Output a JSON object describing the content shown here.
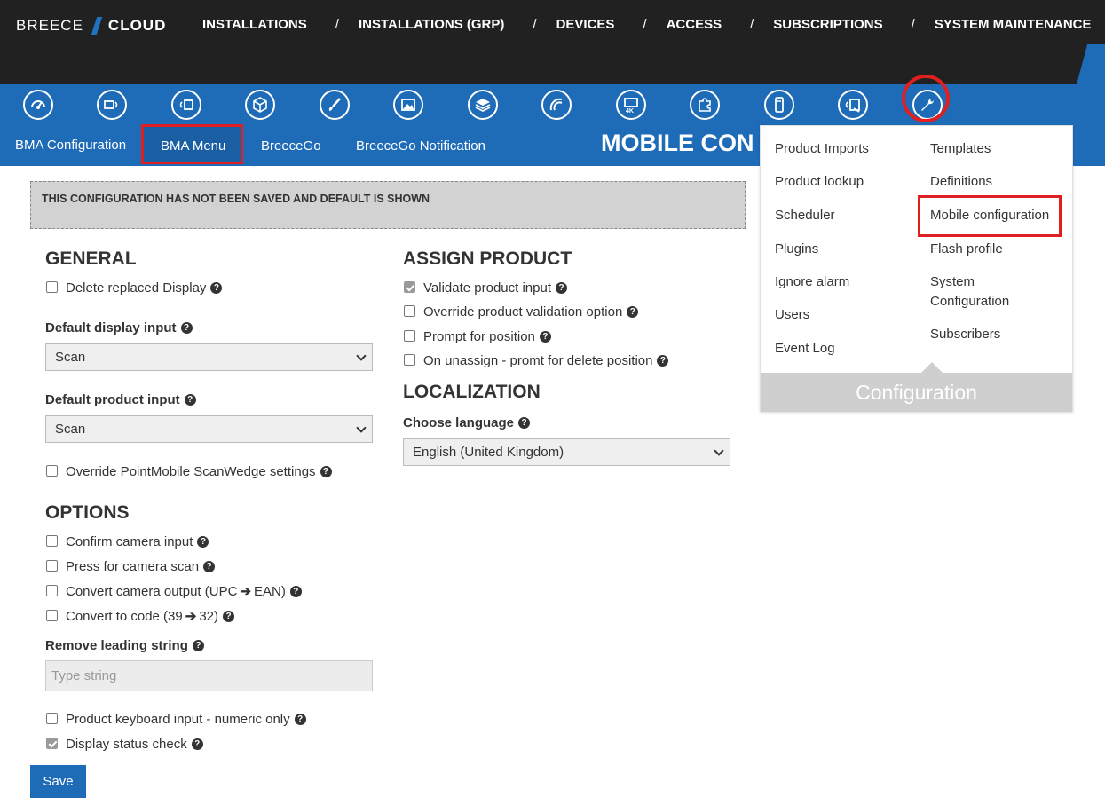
{
  "brand": {
    "left": "BREECE",
    "right": "CLOUD"
  },
  "topnav": [
    "INSTALLATIONS",
    "INSTALLATIONS (GRP)",
    "DEVICES",
    "ACCESS",
    "SUBSCRIPTIONS",
    "SYSTEM MAINTENANCE"
  ],
  "topnav_separator": "/",
  "icons": [
    "dashboard-icon",
    "wireless-display-icon",
    "wall-display-icon",
    "box-icon",
    "brush-icon",
    "images-icon",
    "layers-icon",
    "signal-icon",
    "4k-monitor-icon",
    "puzzle-icon",
    "mobile-scanner-icon",
    "tablet-signal-icon",
    "wrench-icon"
  ],
  "subnav": [
    "BMA Configuration",
    "BMA Menu",
    "BreeceGo",
    "BreeceGo Notification"
  ],
  "page_title": "MOBILE CON",
  "banner": "THIS CONFIGURATION HAS NOT BEEN SAVED AND DEFAULT IS SHOWN",
  "general": {
    "title": "GENERAL",
    "delete_replaced": "Delete replaced Display",
    "default_display_label": "Default display input",
    "default_display_value": "Scan",
    "default_product_label": "Default product input",
    "default_product_value": "Scan",
    "override_scanwedge": "Override PointMobile ScanWedge settings"
  },
  "options": {
    "title": "OPTIONS",
    "confirm_camera": "Confirm camera input",
    "press_camera": "Press for camera scan",
    "convert_camera_a": "Convert camera output (UPC",
    "convert_camera_b": "EAN)",
    "convert_code_a": "Convert to code (39",
    "convert_code_b": "32)",
    "remove_leading_label": "Remove leading string",
    "remove_leading_placeholder": "Type string",
    "keyboard_numeric": "Product keyboard input - numeric only",
    "display_status": "Display status check"
  },
  "assign": {
    "title": "ASSIGN PRODUCT",
    "validate": "Validate product input",
    "override_validation": "Override product validation option",
    "prompt_position": "Prompt for position",
    "unassign_delete": "On unassign - promt for delete position"
  },
  "localization": {
    "title": "LOCALIZATION",
    "choose_label": "Choose language",
    "language_value": "English (United Kingdom)"
  },
  "save_label": "Save",
  "dropdown": {
    "left": [
      "Product Imports",
      "Product lookup",
      "Scheduler",
      "Plugins",
      "Ignore alarm",
      "Users",
      "Event Log"
    ],
    "right": [
      "Templates",
      "Definitions",
      "Mobile configuration",
      "Flash profile",
      "System Configuration",
      "Subscribers"
    ],
    "footer": "Configuration"
  },
  "colors": {
    "brand_blue": "#1e6bb8",
    "dark_bar": "#212121",
    "highlight_red": "#e02020"
  }
}
